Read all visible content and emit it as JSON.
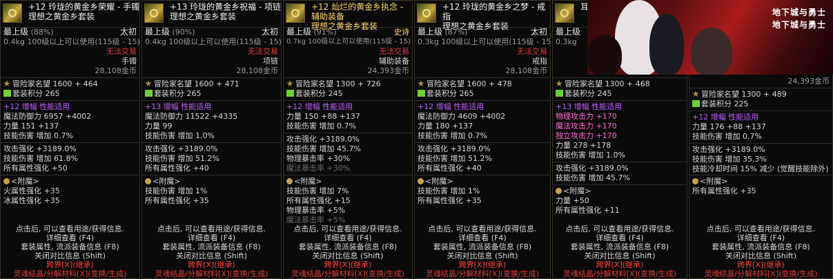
{
  "panels": [
    {
      "title": "+12 玲珑的黄金乡荣耀 - 手镯",
      "set": "理想之黄金乡套装",
      "grade": "最上级",
      "pct": "(88%)",
      "rarity": "太初",
      "weight": "0.4kg",
      "level_req": "100级以上可以使用(115级 - 15)",
      "trade": "无法交易",
      "slot": "手镯",
      "price": "28,108金币",
      "fame_label": "冒险家名望",
      "fame": "1600 + 464",
      "set_label": "套装积分",
      "set_points": "265",
      "amp": "+12 增幅 性能适用",
      "stats": [
        "魔法防御力 6957 +4002",
        "力量 151 +137",
        "技能伤害 增加 0.7%"
      ],
      "stats2": [
        "攻击强化 +3189.0%",
        "技能伤害 增加 61.8%",
        "所有属性强化 +50"
      ],
      "enchant": "<附魔>",
      "enchant_stats": [
        "火属性强化 +35",
        "冰属性强化 +35"
      ]
    },
    {
      "title": "+13 玲珑的黄金乡祝福 - 项链",
      "set": "理想之黄金乡套装",
      "grade": "最上级",
      "pct": "(90%)",
      "rarity": "太初",
      "weight": "0.4kg",
      "level_req": "100级以上可以使用(115级 - 15)",
      "trade": "无法交易",
      "slot": "项链",
      "price": "28,108金币",
      "fame_label": "冒险家名望",
      "fame": "1600 + 471",
      "set_label": "套装积分",
      "set_points": "265",
      "amp": "+13 增幅 性能适用",
      "stats": [
        "魔法防御力 11522 +4335",
        "力量 99",
        "技能伤害 增加 1.0%"
      ],
      "stats2": [
        "攻击强化 +3189.0%",
        "技能伤害 增加 51.2%",
        "所有属性强化 +40"
      ],
      "enchant": "<附魔>",
      "enchant_stats": [
        "技能伤害 增加 1%",
        "所有属性强化 +35"
      ]
    },
    {
      "title": "+12 灿烂的黄金乡执念 - 辅助装备",
      "set": "理想之黄金乡套装",
      "grade": "最上级",
      "pct": "(91%)",
      "rarity": "史诗",
      "weight": "0.7kg",
      "level_req": "100级以上可以使用(115级 - 15)",
      "trade": "无法交易",
      "slot": "辅助装备",
      "price": "24,393金币",
      "fame_label": "冒险家名望",
      "fame": "1300 + 726",
      "set_label": "套装积分",
      "set_points": "245",
      "amp": "+12 增幅 性能适用",
      "stats": [
        "力量 150 +88 +137",
        "技能伤害 增加 0.7%"
      ],
      "stats2": [
        "攻击强化 +3189.0%",
        "技能伤害 增加 45.7%",
        "物理暴击率 +30%",
        "魔法暴击率 +30%"
      ],
      "enchant": "<附魔>",
      "enchant_stats": [
        "技能伤害 增加 7%",
        "所有属性强化 +15",
        "物理暴击率 +5%",
        "魔法暴击率 +5%"
      ]
    },
    {
      "title": "+12 玲珑的黄金乡之梦 - 戒指",
      "set": "理想之黄金乡套装",
      "grade": "最上级",
      "pct": "(87%)",
      "rarity": "太初",
      "weight": "0.3kg",
      "level_req": "100级以上可以使用(115级 - 15)",
      "trade": "无法交易",
      "slot": "戒指",
      "price": "28,108金币",
      "fame_label": "冒险家名望",
      "fame": "1600 + 478",
      "set_label": "套装积分",
      "set_points": "265",
      "amp": "+12 增幅 性能适用",
      "stats": [
        "魔法防御力 4609 +4002",
        "力量 180 +137",
        "技能伤害 增加 0.7%"
      ],
      "stats2": [
        "攻击强化 +3189.0%",
        "技能伤害 增加 51.2%",
        "所有属性强化 +40"
      ],
      "enchant": "<附魔>",
      "enchant_stats": [
        "技能伤害 增加 1%",
        "所有属性强化 +35"
      ]
    },
    {
      "title": "耳",
      "set": "",
      "grade": "最上级",
      "pct": "",
      "rarity": "",
      "weight": "0.3kg",
      "level_req": "",
      "trade": "",
      "slot": "",
      "price": "",
      "fame_label": "冒险家名望",
      "fame": "1300 + 468",
      "set_label": "套装积分",
      "set_points": "245",
      "amp": "+13 增幅 性能适用",
      "stats": [
        "物理攻击力 +170",
        "魔法攻击力 +170",
        "独立攻击力 +170",
        "力量 278 +178",
        "技能伤害 增加 1.0%"
      ],
      "stats2": [
        "攻击强化 +3189.0%",
        "技能伤害 增加 45.7%"
      ],
      "enchant": "<附魔>",
      "enchant_stats": [
        "力量 +50",
        "所有属性强化 +11"
      ]
    },
    {
      "title": "",
      "set": "",
      "grade": "",
      "pct": "",
      "rarity": "",
      "weight": "",
      "level_req": "",
      "trade": "",
      "slot": "",
      "price": "24,393金币",
      "fame_label": "冒险家名望",
      "fame": "1300 + 489",
      "set_label": "套装积分",
      "set_points": "225",
      "amp": "+12 增幅 性能适用",
      "stats": [
        "力量 176 +88 +137",
        "技能伤害 增加 0.7%"
      ],
      "stats2": [
        "攻击强化 +3189.0%",
        "技能伤害 增加 35.3%",
        "技能冷却时间 15% 减少 (觉醒技能除外)"
      ],
      "enchant": "<附魔>",
      "enchant_stats": [
        "所有属性强化 +35"
      ]
    }
  ],
  "footer": {
    "l1": "点击后, 可以查看用途/获得信息.",
    "l2": "详细查看 (F4)",
    "l3": "套装属性, 流派装备信息 (F8)",
    "l4": "关闭对比信息 (Shift)",
    "l5": "跨界[X](继承)",
    "l6": "灵魂结晶/分解材料[X](变换/生成)"
  },
  "banner": {
    "logo1": "地下城与勇士",
    "logo2": "地下城与勇士"
  },
  "colors": {
    "gold": "#ffd96a",
    "red": "#e03c3c",
    "pink": "#ff6ad5",
    "purple": "#c060ff"
  }
}
